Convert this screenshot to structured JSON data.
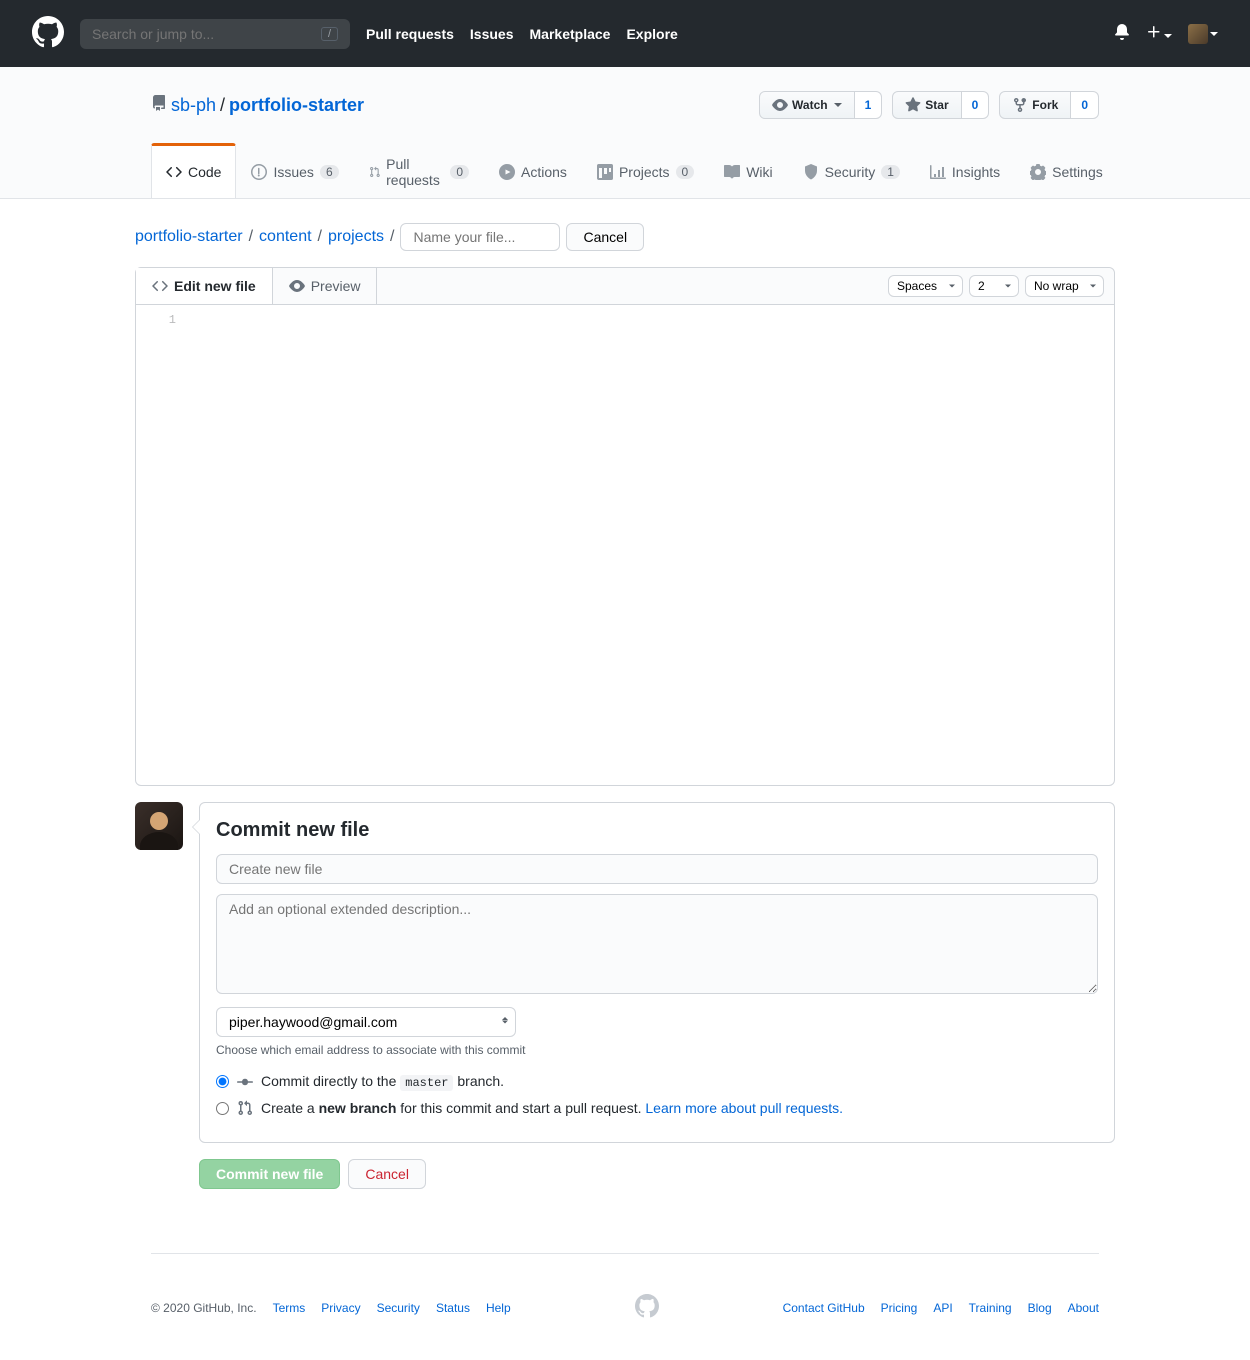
{
  "header": {
    "search_placeholder": "Search or jump to...",
    "slash": "/",
    "nav": {
      "pull_requests": "Pull requests",
      "issues": "Issues",
      "marketplace": "Marketplace",
      "explore": "Explore"
    }
  },
  "repo": {
    "owner": "sb-ph",
    "sep": "/",
    "name": "portfolio-starter",
    "actions": {
      "watch_label": "Watch",
      "watch_count": "1",
      "star_label": "Star",
      "star_count": "0",
      "fork_label": "Fork",
      "fork_count": "0"
    }
  },
  "reponav": {
    "code": "Code",
    "issues": "Issues",
    "issues_count": "6",
    "prs": "Pull requests",
    "prs_count": "0",
    "actions": "Actions",
    "projects": "Projects",
    "projects_count": "0",
    "wiki": "Wiki",
    "security": "Security",
    "security_count": "1",
    "insights": "Insights",
    "settings": "Settings"
  },
  "breadcrumb": {
    "root": "portfolio-starter",
    "p1": "content",
    "p2": "projects",
    "sep": "/",
    "filename_placeholder": "Name your file...",
    "cancel": "Cancel"
  },
  "editor": {
    "tab_edit": "Edit new file",
    "tab_preview": "Preview",
    "indent_mode": "Spaces",
    "indent_size": "2",
    "wrap_mode": "No wrap",
    "line1": "1"
  },
  "commit": {
    "title": "Commit new file",
    "summary_placeholder": "Create new file",
    "desc_placeholder": "Add an optional extended description...",
    "email": "piper.haywood@gmail.com",
    "email_note": "Choose which email address to associate with this commit",
    "direct_pre": "Commit directly to the ",
    "direct_branch": "master",
    "direct_post": " branch.",
    "branch_pre": "Create a ",
    "branch_bold": "new branch",
    "branch_post": " for this commit and start a pull request. ",
    "branch_link": "Learn more about pull requests.",
    "submit": "Commit new file",
    "cancel": "Cancel"
  },
  "footer": {
    "copyright": "© 2020 GitHub, Inc.",
    "terms": "Terms",
    "privacy": "Privacy",
    "security": "Security",
    "status": "Status",
    "help": "Help",
    "contact": "Contact GitHub",
    "pricing": "Pricing",
    "api": "API",
    "training": "Training",
    "blog": "Blog",
    "about": "About"
  }
}
